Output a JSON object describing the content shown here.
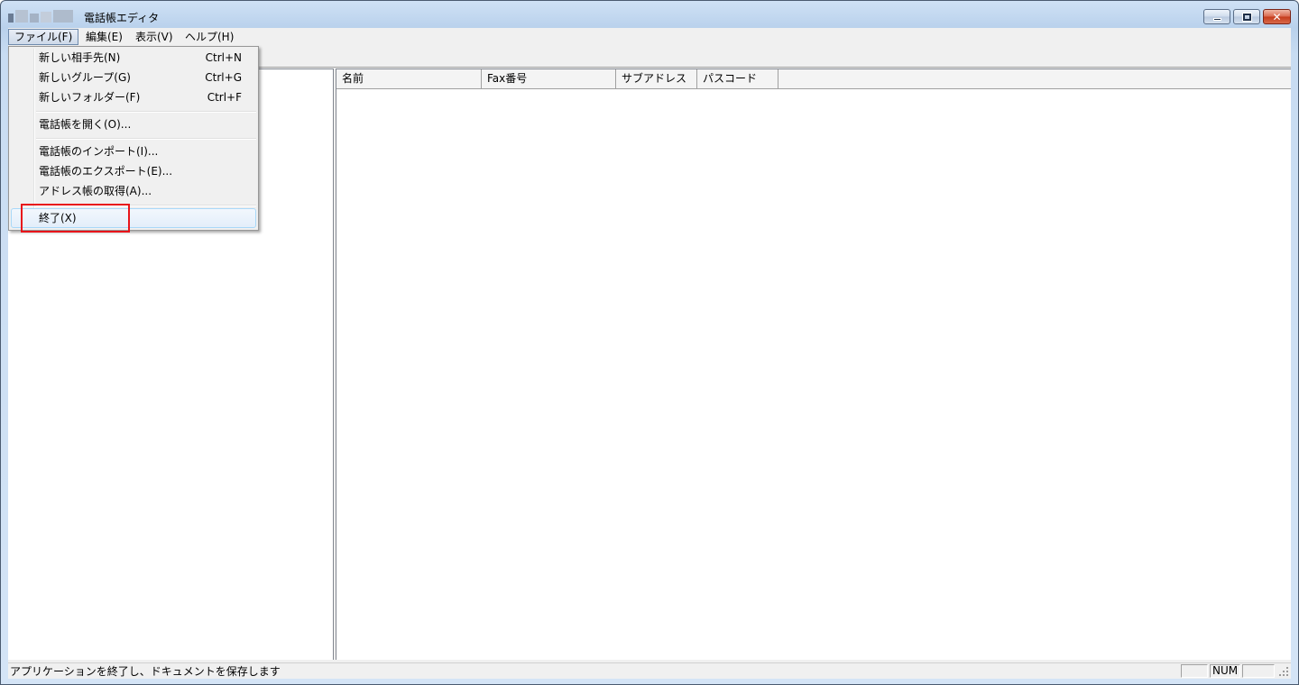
{
  "window": {
    "title": "電話帳エディタ"
  },
  "menubar": {
    "items": [
      {
        "label": "ファイル(F)"
      },
      {
        "label": "編集(E)"
      },
      {
        "label": "表示(V)"
      },
      {
        "label": "ヘルプ(H)"
      }
    ]
  },
  "file_menu": {
    "items": [
      {
        "label": "新しい相手先(N)",
        "shortcut": "Ctrl+N"
      },
      {
        "label": "新しいグループ(G)",
        "shortcut": "Ctrl+G"
      },
      {
        "label": "新しいフォルダー(F)",
        "shortcut": "Ctrl+F"
      },
      {
        "label": "電話帳を開く(O)..."
      },
      {
        "label": "電話帳のインポート(I)..."
      },
      {
        "label": "電話帳のエクスポート(E)..."
      },
      {
        "label": "アドレス帳の取得(A)..."
      },
      {
        "label": "終了(X)"
      }
    ],
    "highlight_color": "#e8141a"
  },
  "list": {
    "columns": [
      {
        "label": "名前"
      },
      {
        "label": "Fax番号"
      },
      {
        "label": "サブアドレス"
      },
      {
        "label": "パスコード"
      }
    ]
  },
  "statusbar": {
    "message": "アプリケーションを終了し、ドキュメントを保存します",
    "panels": [
      {
        "label": ""
      },
      {
        "label": "NUM"
      },
      {
        "label": ""
      }
    ]
  }
}
